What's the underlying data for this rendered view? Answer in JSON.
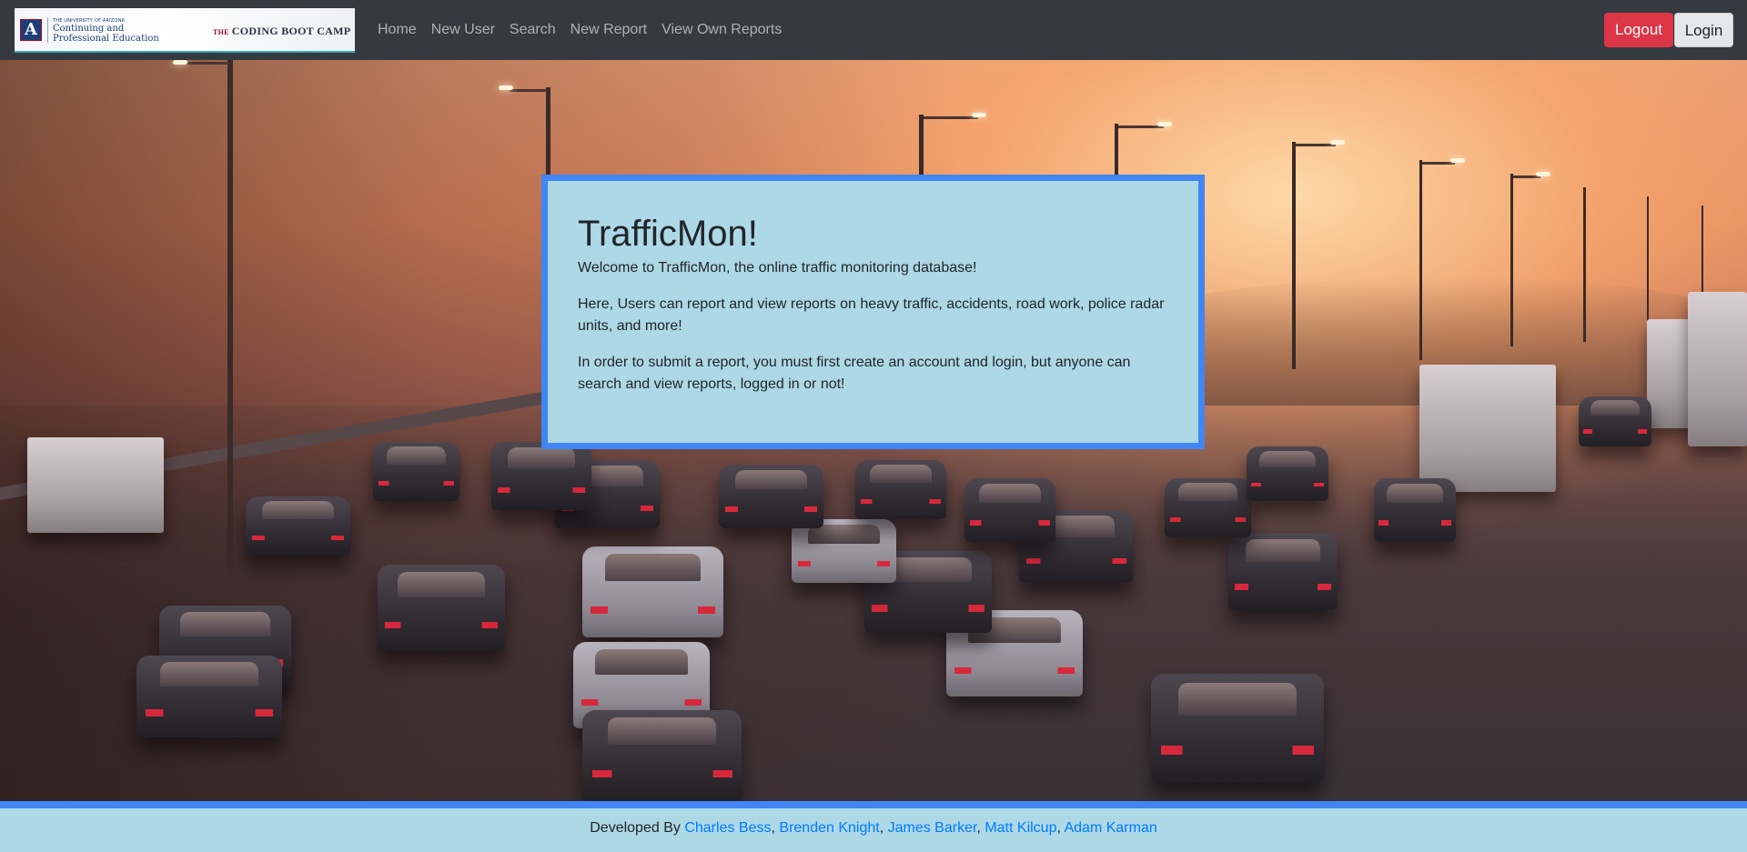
{
  "navbar": {
    "logo": {
      "university_small": "THE UNIVERSITY OF ARIZONA",
      "line1": "Continuing and",
      "line2": "Professional Education",
      "bootcamp_the": "THE",
      "bootcamp_name": "CODING BOOT CAMP"
    },
    "links": [
      "Home",
      "New User",
      "Search",
      "New Report",
      "View Own Reports"
    ],
    "logout_label": "Logout",
    "login_label": "Login"
  },
  "welcome": {
    "title": "TrafficMon!",
    "intro": "Welcome to TrafficMon, the online traffic monitoring database!",
    "paragraph_1": "Here, Users can report and view reports on heavy traffic, accidents, road work, police radar units, and more!",
    "paragraph_2": "In order to submit a report, you must first create an account and login, but anyone can search and view reports, logged in or not!"
  },
  "footer": {
    "prefix": "Developed By",
    "developers": [
      "Charles Bess",
      "Brenden Knight",
      "James Barker",
      "Matt Kilcup",
      "Adam Karman"
    ],
    "separator": ","
  },
  "colors": {
    "navbar_bg": "#343a40",
    "card_bg": "#add8e6",
    "card_border": "#4285f4",
    "logout_bg": "#dc3545",
    "link": "#007bff"
  }
}
